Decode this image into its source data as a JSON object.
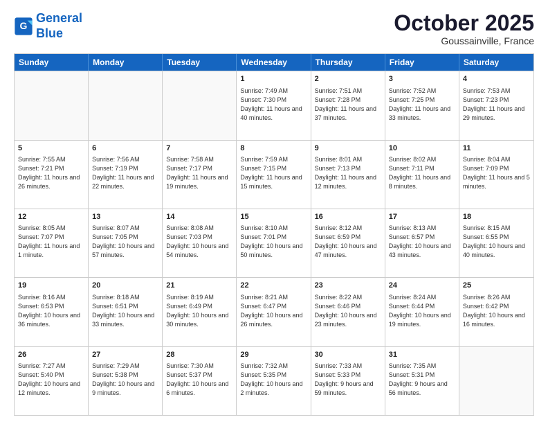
{
  "logo": {
    "line1": "General",
    "line2": "Blue"
  },
  "title": "October 2025",
  "subtitle": "Goussainville, France",
  "days": [
    "Sunday",
    "Monday",
    "Tuesday",
    "Wednesday",
    "Thursday",
    "Friday",
    "Saturday"
  ],
  "rows": [
    [
      {
        "day": "",
        "empty": true
      },
      {
        "day": "",
        "empty": true
      },
      {
        "day": "",
        "empty": true
      },
      {
        "day": "1",
        "sunrise": "Sunrise: 7:49 AM",
        "sunset": "Sunset: 7:30 PM",
        "daylight": "Daylight: 11 hours and 40 minutes."
      },
      {
        "day": "2",
        "sunrise": "Sunrise: 7:51 AM",
        "sunset": "Sunset: 7:28 PM",
        "daylight": "Daylight: 11 hours and 37 minutes."
      },
      {
        "day": "3",
        "sunrise": "Sunrise: 7:52 AM",
        "sunset": "Sunset: 7:25 PM",
        "daylight": "Daylight: 11 hours and 33 minutes."
      },
      {
        "day": "4",
        "sunrise": "Sunrise: 7:53 AM",
        "sunset": "Sunset: 7:23 PM",
        "daylight": "Daylight: 11 hours and 29 minutes."
      }
    ],
    [
      {
        "day": "5",
        "sunrise": "Sunrise: 7:55 AM",
        "sunset": "Sunset: 7:21 PM",
        "daylight": "Daylight: 11 hours and 26 minutes."
      },
      {
        "day": "6",
        "sunrise": "Sunrise: 7:56 AM",
        "sunset": "Sunset: 7:19 PM",
        "daylight": "Daylight: 11 hours and 22 minutes."
      },
      {
        "day": "7",
        "sunrise": "Sunrise: 7:58 AM",
        "sunset": "Sunset: 7:17 PM",
        "daylight": "Daylight: 11 hours and 19 minutes."
      },
      {
        "day": "8",
        "sunrise": "Sunrise: 7:59 AM",
        "sunset": "Sunset: 7:15 PM",
        "daylight": "Daylight: 11 hours and 15 minutes."
      },
      {
        "day": "9",
        "sunrise": "Sunrise: 8:01 AM",
        "sunset": "Sunset: 7:13 PM",
        "daylight": "Daylight: 11 hours and 12 minutes."
      },
      {
        "day": "10",
        "sunrise": "Sunrise: 8:02 AM",
        "sunset": "Sunset: 7:11 PM",
        "daylight": "Daylight: 11 hours and 8 minutes."
      },
      {
        "day": "11",
        "sunrise": "Sunrise: 8:04 AM",
        "sunset": "Sunset: 7:09 PM",
        "daylight": "Daylight: 11 hours and 5 minutes."
      }
    ],
    [
      {
        "day": "12",
        "sunrise": "Sunrise: 8:05 AM",
        "sunset": "Sunset: 7:07 PM",
        "daylight": "Daylight: 11 hours and 1 minute."
      },
      {
        "day": "13",
        "sunrise": "Sunrise: 8:07 AM",
        "sunset": "Sunset: 7:05 PM",
        "daylight": "Daylight: 10 hours and 57 minutes."
      },
      {
        "day": "14",
        "sunrise": "Sunrise: 8:08 AM",
        "sunset": "Sunset: 7:03 PM",
        "daylight": "Daylight: 10 hours and 54 minutes."
      },
      {
        "day": "15",
        "sunrise": "Sunrise: 8:10 AM",
        "sunset": "Sunset: 7:01 PM",
        "daylight": "Daylight: 10 hours and 50 minutes."
      },
      {
        "day": "16",
        "sunrise": "Sunrise: 8:12 AM",
        "sunset": "Sunset: 6:59 PM",
        "daylight": "Daylight: 10 hours and 47 minutes."
      },
      {
        "day": "17",
        "sunrise": "Sunrise: 8:13 AM",
        "sunset": "Sunset: 6:57 PM",
        "daylight": "Daylight: 10 hours and 43 minutes."
      },
      {
        "day": "18",
        "sunrise": "Sunrise: 8:15 AM",
        "sunset": "Sunset: 6:55 PM",
        "daylight": "Daylight: 10 hours and 40 minutes."
      }
    ],
    [
      {
        "day": "19",
        "sunrise": "Sunrise: 8:16 AM",
        "sunset": "Sunset: 6:53 PM",
        "daylight": "Daylight: 10 hours and 36 minutes."
      },
      {
        "day": "20",
        "sunrise": "Sunrise: 8:18 AM",
        "sunset": "Sunset: 6:51 PM",
        "daylight": "Daylight: 10 hours and 33 minutes."
      },
      {
        "day": "21",
        "sunrise": "Sunrise: 8:19 AM",
        "sunset": "Sunset: 6:49 PM",
        "daylight": "Daylight: 10 hours and 30 minutes."
      },
      {
        "day": "22",
        "sunrise": "Sunrise: 8:21 AM",
        "sunset": "Sunset: 6:47 PM",
        "daylight": "Daylight: 10 hours and 26 minutes."
      },
      {
        "day": "23",
        "sunrise": "Sunrise: 8:22 AM",
        "sunset": "Sunset: 6:46 PM",
        "daylight": "Daylight: 10 hours and 23 minutes."
      },
      {
        "day": "24",
        "sunrise": "Sunrise: 8:24 AM",
        "sunset": "Sunset: 6:44 PM",
        "daylight": "Daylight: 10 hours and 19 minutes."
      },
      {
        "day": "25",
        "sunrise": "Sunrise: 8:26 AM",
        "sunset": "Sunset: 6:42 PM",
        "daylight": "Daylight: 10 hours and 16 minutes."
      }
    ],
    [
      {
        "day": "26",
        "sunrise": "Sunrise: 7:27 AM",
        "sunset": "Sunset: 5:40 PM",
        "daylight": "Daylight: 10 hours and 12 minutes."
      },
      {
        "day": "27",
        "sunrise": "Sunrise: 7:29 AM",
        "sunset": "Sunset: 5:38 PM",
        "daylight": "Daylight: 10 hours and 9 minutes."
      },
      {
        "day": "28",
        "sunrise": "Sunrise: 7:30 AM",
        "sunset": "Sunset: 5:37 PM",
        "daylight": "Daylight: 10 hours and 6 minutes."
      },
      {
        "day": "29",
        "sunrise": "Sunrise: 7:32 AM",
        "sunset": "Sunset: 5:35 PM",
        "daylight": "Daylight: 10 hours and 2 minutes."
      },
      {
        "day": "30",
        "sunrise": "Sunrise: 7:33 AM",
        "sunset": "Sunset: 5:33 PM",
        "daylight": "Daylight: 9 hours and 59 minutes."
      },
      {
        "day": "31",
        "sunrise": "Sunrise: 7:35 AM",
        "sunset": "Sunset: 5:31 PM",
        "daylight": "Daylight: 9 hours and 56 minutes."
      },
      {
        "day": "",
        "empty": true
      }
    ]
  ]
}
